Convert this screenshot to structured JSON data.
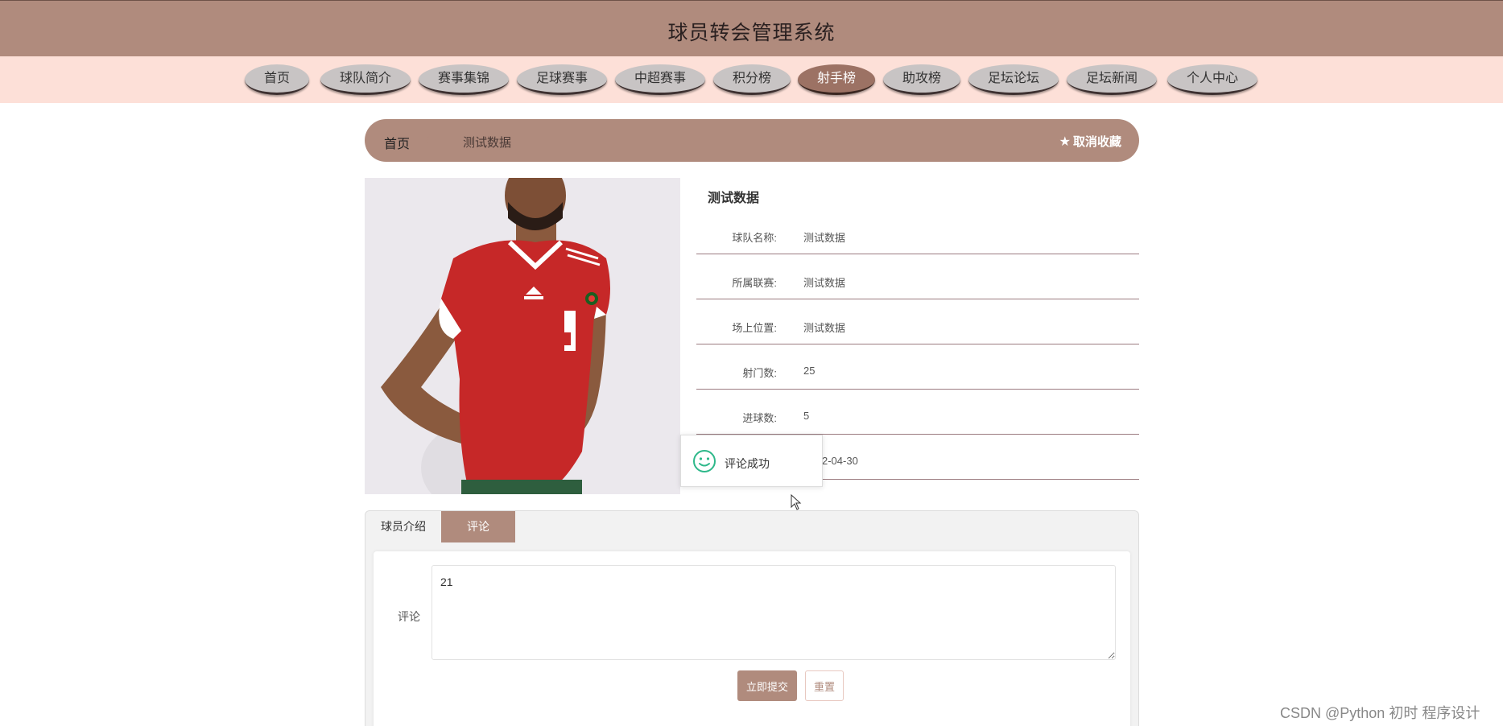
{
  "header": {
    "title": "球员转会管理系统"
  },
  "nav": {
    "items": [
      {
        "label": "首页"
      },
      {
        "label": "球队简介"
      },
      {
        "label": "赛事集锦"
      },
      {
        "label": "足球赛事"
      },
      {
        "label": "中超赛事"
      },
      {
        "label": "积分榜"
      },
      {
        "label": "射手榜",
        "active": true
      },
      {
        "label": "助攻榜"
      },
      {
        "label": "足坛论坛"
      },
      {
        "label": "足坛新闻"
      },
      {
        "label": "个人中心"
      }
    ]
  },
  "breadcrumb": {
    "home": "首页",
    "separator": "/",
    "current": "测试数据",
    "favorite_label": "取消收藏"
  },
  "detail": {
    "title": "测试数据",
    "rows": [
      {
        "label": "球队名称:",
        "value": "测试数据"
      },
      {
        "label": "所属联赛:",
        "value": "测试数据"
      },
      {
        "label": "场上位置:",
        "value": "测试数据"
      },
      {
        "label": "射门数:",
        "value": "25"
      },
      {
        "label": "进球数:",
        "value": "5"
      },
      {
        "label": "",
        "value": "2-04-30"
      }
    ]
  },
  "toast": {
    "message": "评论成功"
  },
  "tabs": {
    "intro": "球员介绍",
    "comment": "评论"
  },
  "comment_form": {
    "label": "评论",
    "value": "21",
    "submit_label": "立即提交",
    "reset_label": "重置"
  },
  "watermark": "CSDN @Python 初时 程序设计",
  "colors": {
    "brand": "#b08b7d",
    "nav_bg": "#fde0d8",
    "toast_icon": "#2eb88a"
  }
}
